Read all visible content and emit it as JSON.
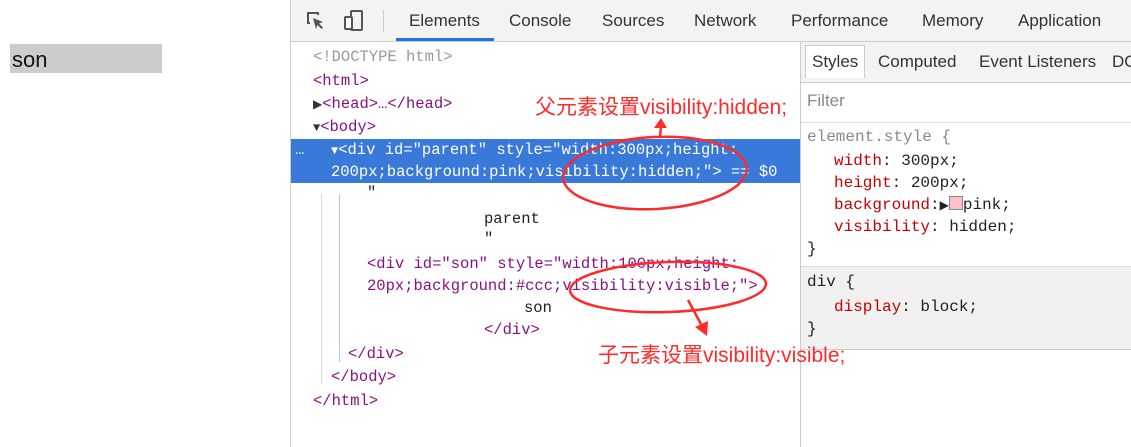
{
  "page": {
    "son_text": "son"
  },
  "devtools": {
    "tabs": [
      "Elements",
      "Console",
      "Sources",
      "Network",
      "Performance",
      "Memory",
      "Application"
    ],
    "active_tab": "Elements",
    "icons": [
      "inspect-element-icon",
      "device-toggle-icon"
    ],
    "tree": {
      "doctype": "<!DOCTYPE html>",
      "html_open": "<html>",
      "head": "<head>…</head>",
      "body_open": "<body>",
      "parent_div_line1": "<div id=\"parent\" style=\"width:300px;height:",
      "parent_div_line2": "200px;background:pink;visibility:hidden;\"> == $0",
      "quote1": "\"",
      "parent_text": "parent",
      "quote2": "\"",
      "son_div_line1": "<div id=\"son\" style=\"width:100px;height:",
      "son_div_line2": "20px;background:#ccc;visibility:visible;\">",
      "son_text": "son",
      "son_close": "</div>",
      "parent_close": "</div>",
      "body_close": "</body>",
      "html_close": "</html>",
      "ellipsis": "…"
    },
    "styles_pane": {
      "tabs": [
        "Styles",
        "Computed",
        "Event Listeners",
        "DO"
      ],
      "filter_placeholder": "Filter",
      "element_style": {
        "selector": "element.style {",
        "rules": [
          {
            "prop": "width",
            "value": "300px;"
          },
          {
            "prop": "height",
            "value": "200px;"
          },
          {
            "prop": "background",
            "value": "pink;",
            "swatch": "#ffc0cb"
          },
          {
            "prop": "visibility",
            "value": "hidden;"
          }
        ],
        "close": "}"
      },
      "div_rule": {
        "selector": "div {",
        "rules": [
          {
            "prop": "display",
            "value": "block;"
          }
        ],
        "close": "}"
      }
    }
  },
  "annotations": {
    "parent_note": "父元素设置visibility:hidden;",
    "son_note": "子元素设置visibility:visible;",
    "color": "#ff2a2a"
  }
}
